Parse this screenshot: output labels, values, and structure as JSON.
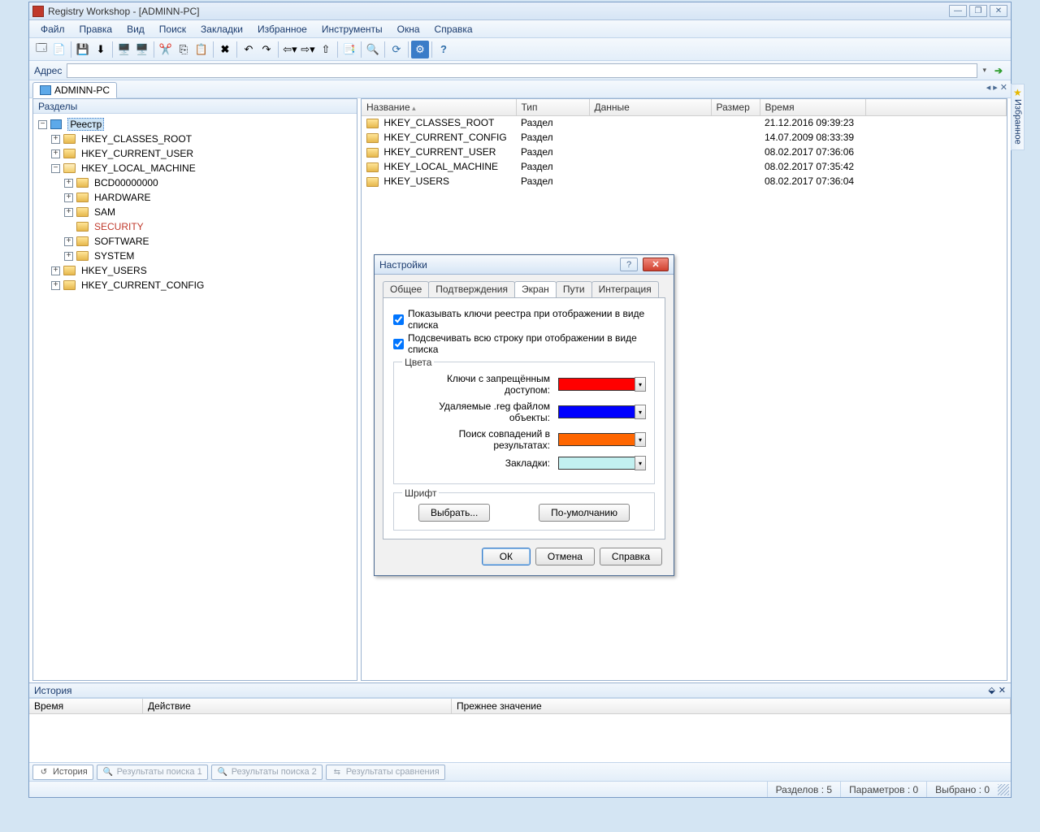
{
  "titlebar": {
    "text": "Registry Workshop - [ADMINN-PC]"
  },
  "menu": {
    "items": [
      "Файл",
      "Правка",
      "Вид",
      "Поиск",
      "Закладки",
      "Избранное",
      "Инструменты",
      "Окна",
      "Справка"
    ]
  },
  "address": {
    "label": "Адрес"
  },
  "doc_tab": {
    "label": "ADMINN-PC"
  },
  "sidelabel": {
    "text": "Избранное"
  },
  "left_pane": {
    "title": "Разделы"
  },
  "tree": {
    "root": "Реестр",
    "hklm_children": [
      "BCD00000000",
      "HARDWARE",
      "SAM",
      "SECURITY",
      "SOFTWARE",
      "SYSTEM"
    ],
    "top": {
      "hkcr": "HKEY_CLASSES_ROOT",
      "hkcu": "HKEY_CURRENT_USER",
      "hklm": "HKEY_LOCAL_MACHINE",
      "hku": "HKEY_USERS",
      "hkcc": "HKEY_CURRENT_CONFIG"
    }
  },
  "list": {
    "cols": {
      "name": "Название",
      "type": "Тип",
      "data": "Данные",
      "size": "Размер",
      "time": "Время"
    },
    "type_label": "Раздел",
    "rows": [
      {
        "name": "HKEY_CLASSES_ROOT",
        "time": "21.12.2016 09:39:23"
      },
      {
        "name": "HKEY_CURRENT_CONFIG",
        "time": "14.07.2009 08:33:39"
      },
      {
        "name": "HKEY_CURRENT_USER",
        "time": "08.02.2017 07:36:06"
      },
      {
        "name": "HKEY_LOCAL_MACHINE",
        "time": "08.02.2017 07:35:42"
      },
      {
        "name": "HKEY_USERS",
        "time": "08.02.2017 07:36:04"
      }
    ]
  },
  "history": {
    "title": "История",
    "cols": {
      "time": "Время",
      "action": "Действие",
      "prev": "Прежнее значение"
    }
  },
  "bottom_tabs": {
    "t1": "История",
    "t2": "Результаты поиска 1",
    "t3": "Результаты поиска 2",
    "t4": "Результаты сравнения"
  },
  "status": {
    "keys": "Разделов : 5",
    "params": "Параметров : 0",
    "selected": "Выбрано : 0"
  },
  "dialog": {
    "title": "Настройки",
    "tabs": {
      "general": "Общее",
      "confirm": "Подтверждения",
      "screen": "Экран",
      "paths": "Пути",
      "integ": "Интеграция"
    },
    "chk1": "Показывать ключи реестра при отображении в виде списка",
    "chk2": "Подсвечивать всю строку при отображении в виде списка",
    "colors_legend": "Цвета",
    "row1": "Ключи с запрещённым доступом:",
    "row2": "Удаляемые .reg файлом объекты:",
    "row3": "Поиск совпадений в результатах:",
    "row4": "Закладки:",
    "color1": "#ff0000",
    "color2": "#0000ff",
    "color3": "#ff6600",
    "color4": "#c2f0f0",
    "font_legend": "Шрифт",
    "btn_choose": "Выбрать...",
    "btn_default": "По-умолчанию",
    "ok": "ОК",
    "cancel": "Отмена",
    "help": "Справка"
  }
}
